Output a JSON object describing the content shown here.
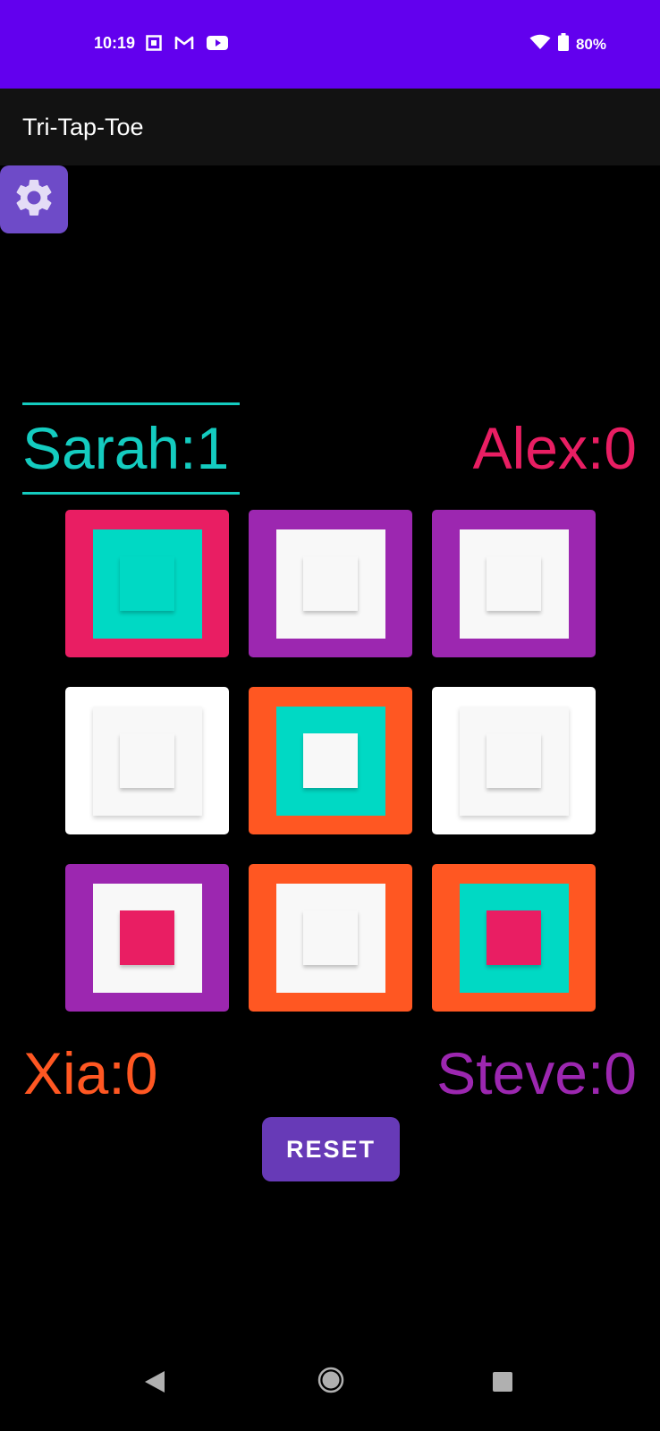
{
  "status_bar": {
    "time": "10:19",
    "left_icons": [
      "screen-record-icon",
      "gmail-icon",
      "youtube-icon"
    ],
    "right_icons": [
      "wifi-icon",
      "battery-icon"
    ],
    "battery": "80%"
  },
  "app_bar": {
    "title": "Tri-Tap-Toe"
  },
  "settings": {
    "icon": "gear-icon"
  },
  "players": {
    "sarah": {
      "label": "Sarah:1",
      "color": "#14CCC0",
      "active": true
    },
    "alex": {
      "label": "Alex:0",
      "color": "#E91E63"
    },
    "xia": {
      "label": "Xia:0",
      "color": "#FF5722"
    },
    "steve": {
      "label": "Steve:0",
      "color": "#9C27B0"
    }
  },
  "board": [
    {
      "outer": "#E91E63",
      "middle": "#00D9C4",
      "inner": "#00D9C4"
    },
    {
      "outer": "#9C27B0",
      "middle": "#F8F8F8",
      "inner": "#F8F8F8"
    },
    {
      "outer": "#9C27B0",
      "middle": "#F8F8F8",
      "inner": "#F8F8F8"
    },
    {
      "outer": "#FFFFFF",
      "middle": "#F8F8F8",
      "inner": "#F8F8F8"
    },
    {
      "outer": "#FF5722",
      "middle": "#00D9C4",
      "inner": "#F8F8F8"
    },
    {
      "outer": "#FFFFFF",
      "middle": "#F8F8F8",
      "inner": "#F8F8F8"
    },
    {
      "outer": "#9C27B0",
      "middle": "#F8F8F8",
      "inner": "#E91E63"
    },
    {
      "outer": "#FF5722",
      "middle": "#F8F8F8",
      "inner": "#F8F8F8"
    },
    {
      "outer": "#FF5722",
      "middle": "#00D9C4",
      "inner": "#E91E63"
    }
  ],
  "reset_button": {
    "label": "RESET"
  },
  "nav_bar": {
    "icons": [
      "back-icon",
      "home-icon",
      "recents-icon"
    ]
  }
}
